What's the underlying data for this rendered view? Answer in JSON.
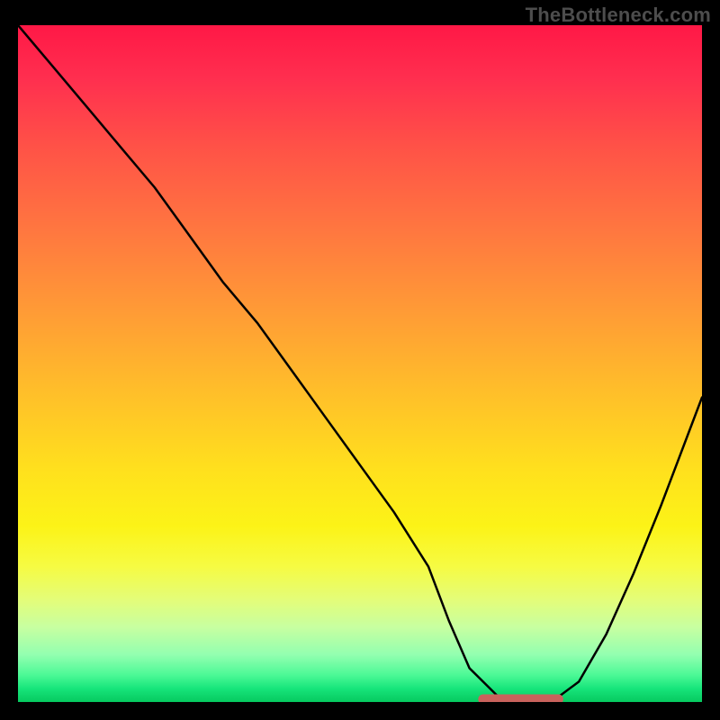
{
  "watermark": "TheBottleneck.com",
  "chart_data": {
    "type": "line",
    "title": "",
    "xlabel": "",
    "ylabel": "",
    "xlim": [
      0,
      100
    ],
    "ylim": [
      0,
      100
    ],
    "grid": false,
    "legend": false,
    "annotations": [],
    "series": [
      {
        "name": "bottleneck-curve",
        "color": "#000000",
        "x": [
          0,
          5,
          10,
          15,
          20,
          25,
          30,
          35,
          40,
          45,
          50,
          55,
          60,
          63,
          66,
          70,
          74,
          78,
          82,
          86,
          90,
          94,
          100
        ],
        "y": [
          100,
          94,
          88,
          82,
          76,
          69,
          62,
          56,
          49,
          42,
          35,
          28,
          20,
          12,
          5,
          1,
          0,
          0,
          3,
          10,
          19,
          29,
          45
        ]
      }
    ],
    "flat_region": {
      "x_start": 68,
      "x_end": 79,
      "y": 0.4,
      "color": "#c9625c"
    },
    "background_gradient": {
      "direction": "vertical",
      "stops": [
        {
          "pos": 0,
          "color": "#ff1846"
        },
        {
          "pos": 18,
          "color": "#ff5247"
        },
        {
          "pos": 42,
          "color": "#ff9a36"
        },
        {
          "pos": 66,
          "color": "#ffe11d"
        },
        {
          "pos": 85,
          "color": "#e3fd7a"
        },
        {
          "pos": 100,
          "color": "#06c95f"
        }
      ]
    }
  }
}
